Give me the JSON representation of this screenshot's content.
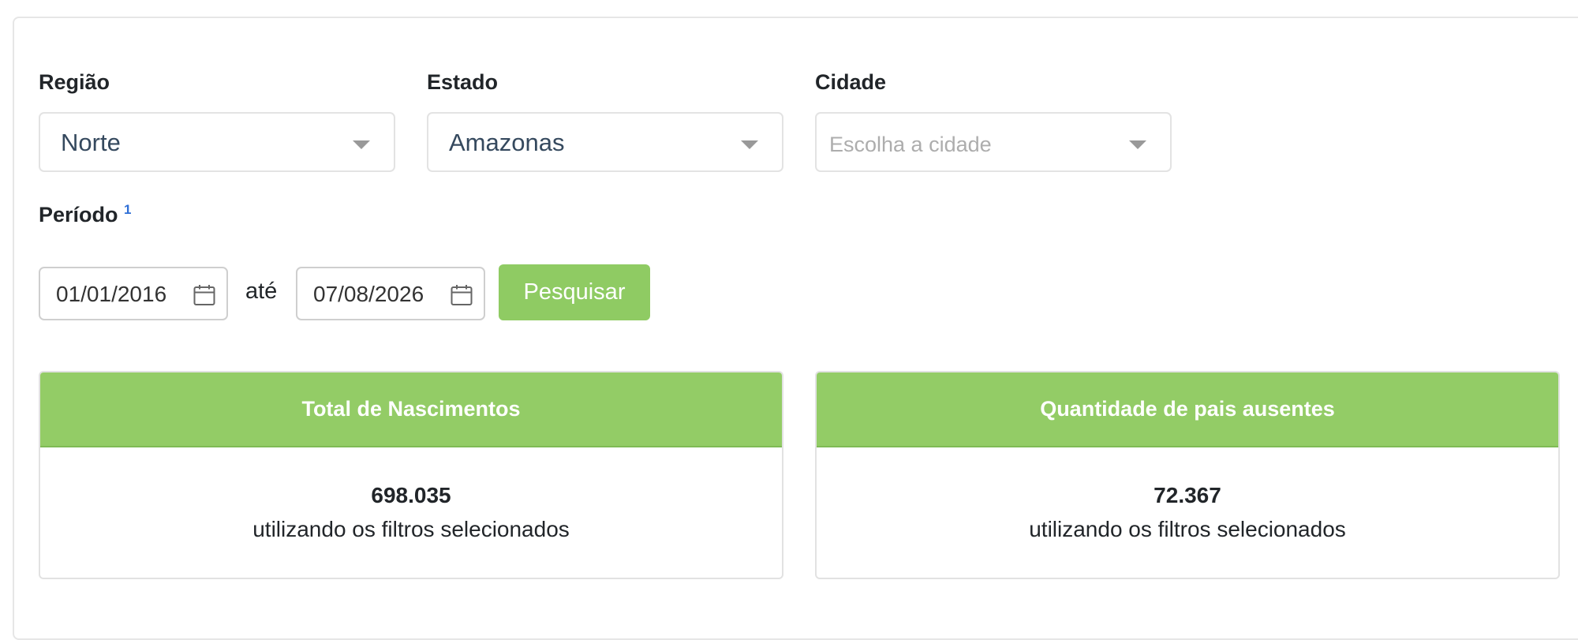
{
  "filters": {
    "regiao": {
      "label": "Região",
      "value": "Norte"
    },
    "estado": {
      "label": "Estado",
      "value": "Amazonas"
    },
    "cidade": {
      "label": "Cidade",
      "placeholder": "Escolha a cidade"
    }
  },
  "periodo": {
    "label": "Período",
    "footnote": "1",
    "start_date": "01/01/2016",
    "separator": "até",
    "end_date": "07/08/2026"
  },
  "search_button": {
    "label": "Pesquisar"
  },
  "stats": [
    {
      "title": "Total de Nascimentos",
      "value": "698.035",
      "caption": "utilizando os filtros selecionados"
    },
    {
      "title": "Quantidade de pais ausentes",
      "value": "72.367",
      "caption": "utilizando os filtros selecionados"
    }
  ],
  "colors": {
    "accent_green": "#93cc66",
    "footnote_blue": "#2f6fd6"
  },
  "icons": {
    "dropdown": "chevron-down-icon",
    "date": "calendar-icon"
  }
}
